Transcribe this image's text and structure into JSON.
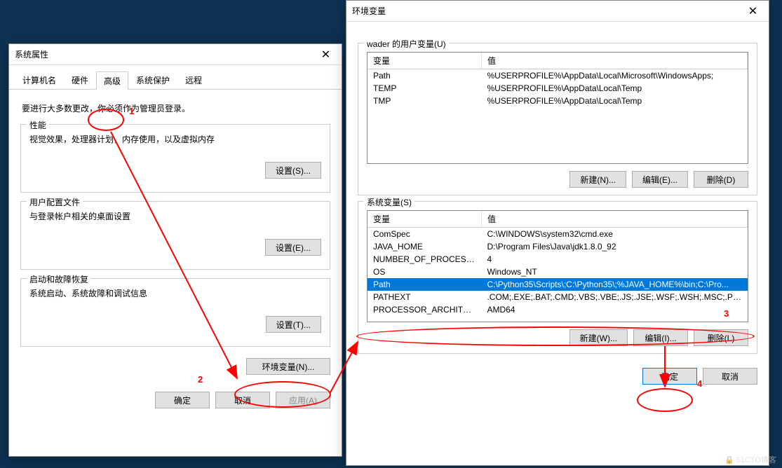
{
  "sys_props": {
    "title": "系统属性",
    "tabs": [
      "计算机名",
      "硬件",
      "高级",
      "系统保护",
      "远程"
    ],
    "note": "要进行大多数更改，你必须作为管理员登录。",
    "perf": {
      "title": "性能",
      "desc": "视觉效果，处理器计划，内存使用，以及虚拟内存",
      "btn": "设置(S)..."
    },
    "profile": {
      "title": "用户配置文件",
      "desc": "与登录帐户相关的桌面设置",
      "btn": "设置(E)..."
    },
    "startup": {
      "title": "启动和故障恢复",
      "desc": "系统启动、系统故障和调试信息",
      "btn": "设置(T)..."
    },
    "env_btn": "环境变量(N)...",
    "ok": "确定",
    "cancel": "取消",
    "apply": "应用(A)"
  },
  "env": {
    "title": "环境变量",
    "user_group": "wader 的用户变量(U)",
    "sys_group": "系统变量(S)",
    "col_var": "变量",
    "col_val": "值",
    "user_vars": [
      {
        "name": "Path",
        "value": "%USERPROFILE%\\AppData\\Local\\Microsoft\\WindowsApps;"
      },
      {
        "name": "TEMP",
        "value": "%USERPROFILE%\\AppData\\Local\\Temp"
      },
      {
        "name": "TMP",
        "value": "%USERPROFILE%\\AppData\\Local\\Temp"
      }
    ],
    "sys_vars": [
      {
        "name": "ComSpec",
        "value": "C:\\WINDOWS\\system32\\cmd.exe"
      },
      {
        "name": "JAVA_HOME",
        "value": "D:\\Program Files\\Java\\jdk1.8.0_92"
      },
      {
        "name": "NUMBER_OF_PROCESSORS",
        "value": "4"
      },
      {
        "name": "OS",
        "value": "Windows_NT"
      },
      {
        "name": "Path",
        "value": "C:\\Python35\\Scripts\\;C:\\Python35\\;%JAVA_HOME%\\bin;C:\\Pro..."
      },
      {
        "name": "PATHEXT",
        "value": ".COM;.EXE;.BAT;.CMD;.VBS;.VBE;.JS;.JSE;.WSF;.WSH;.MSC;.PY;.P..."
      },
      {
        "name": "PROCESSOR_ARCHITECT...",
        "value": "AMD64"
      }
    ],
    "new_u": "新建(N)...",
    "edit_u": "编辑(E)...",
    "del_u": "删除(D)",
    "new_s": "新建(W)...",
    "edit_s": "编辑(I)...",
    "del_s": "删除(L)",
    "ok": "确定",
    "cancel": "取消"
  },
  "anno": {
    "n1": "1",
    "n2": "2",
    "n3": "3",
    "n4": "4"
  },
  "watermark": "🔒 51CTO博客"
}
